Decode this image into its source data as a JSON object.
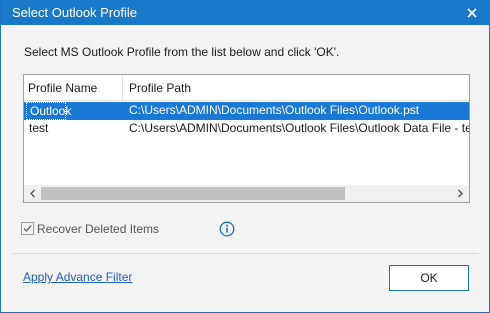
{
  "dialog": {
    "title": "Select Outlook Profile",
    "instruction": "Select MS Outlook Profile from the list below and click 'OK'."
  },
  "profiles_table": {
    "columns": [
      "Profile Name",
      "Profile Path"
    ],
    "rows": [
      {
        "name": "Outlook",
        "path": "C:\\Users\\ADMIN\\Documents\\Outlook Files\\Outlook.pst",
        "selected": true
      },
      {
        "name": "test",
        "path": "C:\\Users\\ADMIN\\Documents\\Outlook Files\\Outlook Data File - test.pst",
        "selected": false
      }
    ]
  },
  "options": {
    "recover_deleted_label": "Recover Deleted Items",
    "recover_deleted_checked": true
  },
  "footer": {
    "advance_filter_link": "Apply Advance Filter",
    "ok_label": "OK"
  },
  "icons": {
    "close": "close-icon",
    "info": "info-icon",
    "scroll_left": "chevron-left-icon",
    "scroll_right": "chevron-right-icon",
    "check": "checkmark-icon"
  },
  "colors": {
    "titlebar": "#1a78c8",
    "selection": "#1a78d6",
    "link": "#1f5fbf",
    "accent": "#1a73c2"
  }
}
